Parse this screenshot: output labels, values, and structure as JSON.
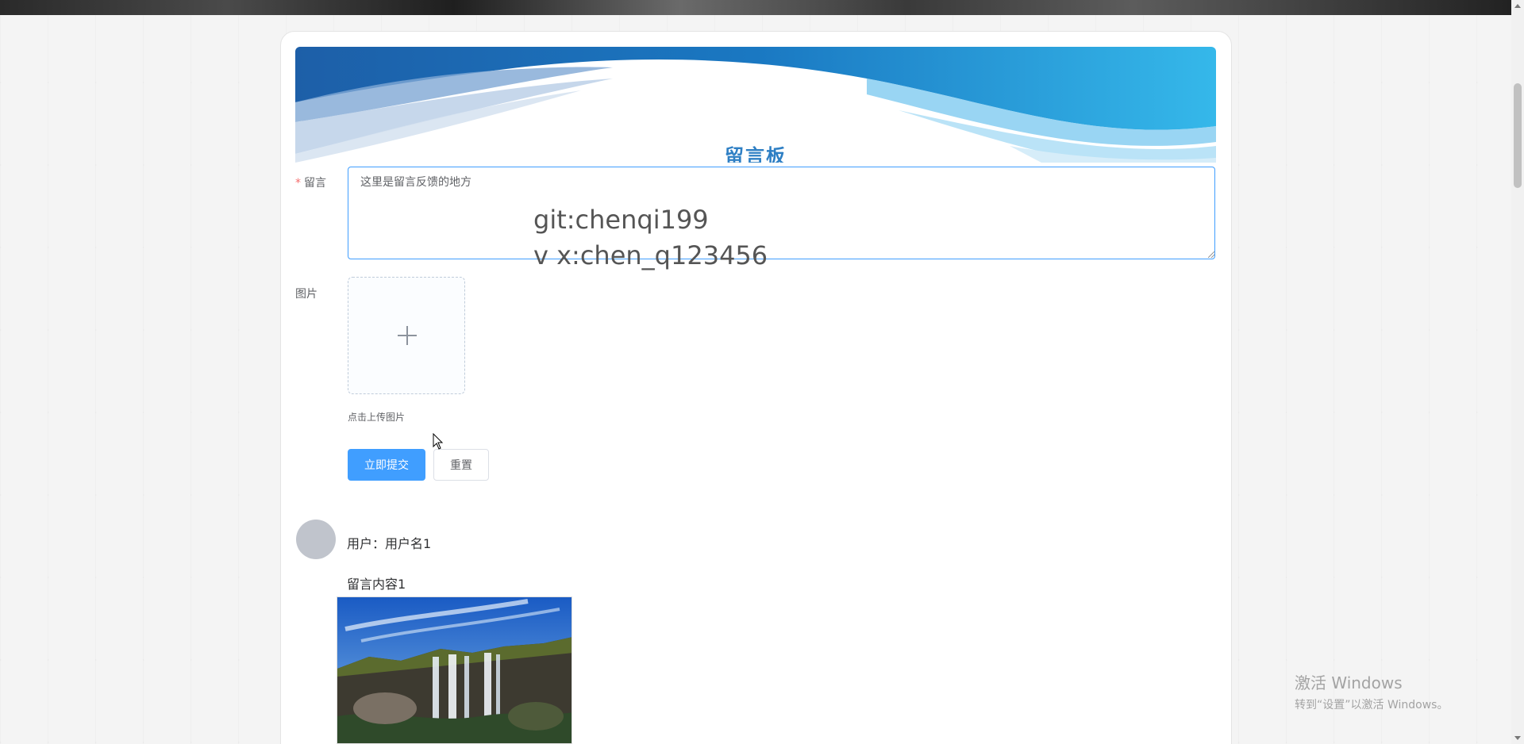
{
  "banner": {
    "title": "留言板"
  },
  "form": {
    "message_label": "留言",
    "message_required_mark": "*",
    "message_value": "这里是留言反馈的地方",
    "image_label": "图片",
    "upload_tip": "点击上传图片",
    "submit_label": "立即提交",
    "reset_label": "重置"
  },
  "overlay": {
    "line1": "git:chenqi199",
    "line2": "v x:chen_q123456"
  },
  "messages": [
    {
      "user_prefix": "用户：",
      "username": "用户名1",
      "content": "留言内容1"
    }
  ],
  "os_watermark": {
    "line1": "激活 Windows",
    "line2": "转到“设置”以激活 Windows。"
  },
  "colors": {
    "primary": "#409eff",
    "banner_title": "#2e7fc4",
    "required": "#f56c6c"
  },
  "icons": {
    "upload": "plus-icon",
    "cursor": "mouse-cursor-icon"
  }
}
